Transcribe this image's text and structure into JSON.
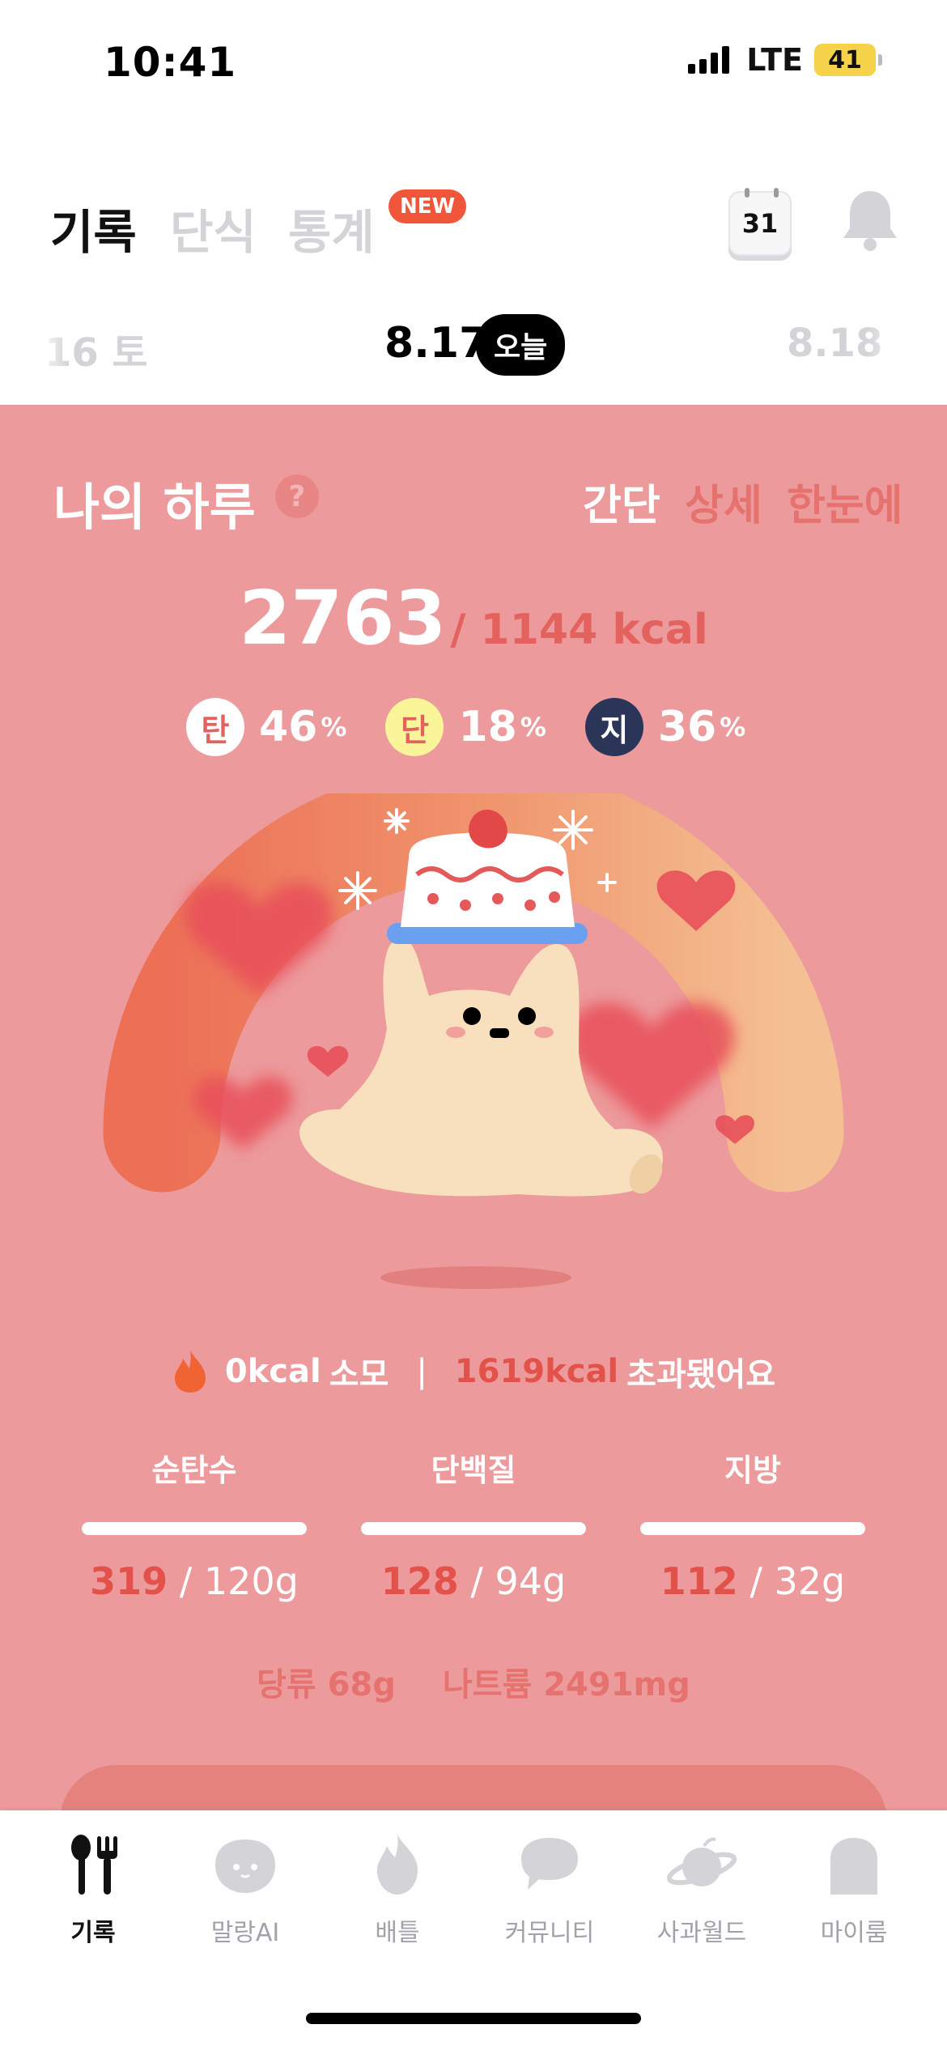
{
  "status_bar": {
    "time": "10:41",
    "network": "LTE",
    "battery": "41"
  },
  "tabs": [
    {
      "label": "기록",
      "active": true
    },
    {
      "label": "단식",
      "active": false
    },
    {
      "label": "통계",
      "active": false,
      "badge": "NEW"
    }
  ],
  "header_icons": {
    "calendar_day": "31",
    "calendar_icon": "calendar-icon",
    "bell_icon": "bell-icon"
  },
  "date_nav": {
    "prev": "16 토",
    "current": "8.17",
    "today_badge": "오늘",
    "next": "8.18"
  },
  "summary": {
    "title": "나의 하루",
    "help": "?",
    "view_options": [
      "간단",
      "상세",
      "한눈에"
    ],
    "selected_view": "간단",
    "kcal_eaten": "2763",
    "kcal_target": "/ 1144 kcal",
    "ratios": [
      {
        "chip": "탄",
        "value": "46",
        "unit": "%"
      },
      {
        "chip": "단",
        "value": "18",
        "unit": "%"
      },
      {
        "chip": "지",
        "value": "36",
        "unit": "%"
      }
    ],
    "burn": {
      "value": "0kcal",
      "label": "소모",
      "separator": "|",
      "over_value": "1619kcal",
      "over_label": "초과됐어요"
    },
    "macros": [
      {
        "label": "순탄수",
        "eaten": "319",
        "target": " / 120g"
      },
      {
        "label": "단백질",
        "eaten": "128",
        "target": " / 94g"
      },
      {
        "label": "지방",
        "eaten": "112",
        "target": " / 32g"
      }
    ],
    "extras": {
      "sugar": "당류 68g",
      "sodium": "나트륨 2491mg"
    }
  },
  "colors": {
    "card_bg": "#ec9a9b",
    "accent_red": "#e3524a",
    "badge_new": "#f1563a",
    "fat_chip": "#2a3558",
    "protein_chip": "#fbf59a"
  },
  "bottom_nav": [
    {
      "label": "기록",
      "icon": "fork-knife-icon",
      "active": true
    },
    {
      "label": "말랑AI",
      "icon": "malang-face-icon",
      "active": false
    },
    {
      "label": "배틀",
      "icon": "flame-icon",
      "active": false
    },
    {
      "label": "커뮤니티",
      "icon": "speech-bubble-icon",
      "active": false
    },
    {
      "label": "사과월드",
      "icon": "planet-icon",
      "active": false
    },
    {
      "label": "마이룸",
      "icon": "ghost-room-icon",
      "active": false
    }
  ]
}
